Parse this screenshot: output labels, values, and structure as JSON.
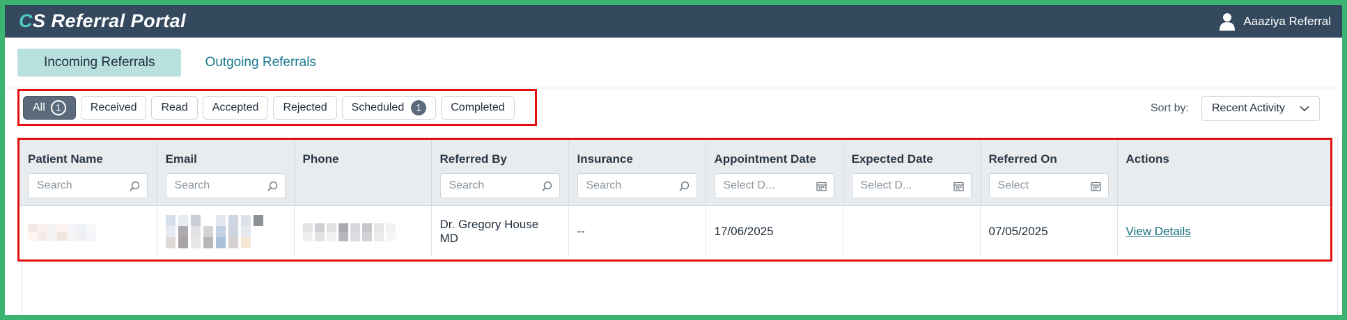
{
  "app": {
    "brand_first_letter": "C",
    "brand_rest": "S Referral Portal",
    "user_name": "Aaaziya Referral"
  },
  "tabs": [
    {
      "label": "Incoming Referrals",
      "active": true
    },
    {
      "label": "Outgoing Referrals",
      "active": false
    }
  ],
  "filters": [
    {
      "label": "All",
      "count": "1",
      "active": true
    },
    {
      "label": "Received"
    },
    {
      "label": "Read"
    },
    {
      "label": "Accepted"
    },
    {
      "label": "Rejected"
    },
    {
      "label": "Scheduled",
      "count": "1"
    },
    {
      "label": "Completed"
    }
  ],
  "sort": {
    "label": "Sort by:",
    "value": "Recent Activity"
  },
  "table": {
    "columns": [
      {
        "label": "Patient Name",
        "filter": "Search",
        "filter_icon": "search-icon"
      },
      {
        "label": "Email",
        "filter": "Search",
        "filter_icon": "search-icon"
      },
      {
        "label": "Phone",
        "filter": null
      },
      {
        "label": "Referred By",
        "filter": "Search",
        "filter_icon": "search-icon"
      },
      {
        "label": "Insurance",
        "filter": "Search",
        "filter_icon": "search-icon"
      },
      {
        "label": "Appointment Date",
        "filter": "Select D...",
        "filter_icon": "calendar-icon"
      },
      {
        "label": "Expected Date",
        "filter": "Select D...",
        "filter_icon": "calendar-icon"
      },
      {
        "label": "Referred On",
        "filter": "Select",
        "filter_icon": "calendar-icon"
      },
      {
        "label": "Actions",
        "filter": null
      }
    ],
    "rows": [
      {
        "patient_name": "",
        "email": "",
        "phone": "",
        "referred_by": "Dr. Gregory House MD",
        "insurance": "--",
        "appointment_date": "17/06/2025",
        "expected_date": "",
        "referred_on": "07/05/2025",
        "action": "View Details"
      }
    ]
  },
  "colors": {
    "topbar": "#34495e",
    "accent": "#4ecdc4",
    "highlight_border": "#e01010",
    "frame_border": "#3cb371",
    "link": "#136c7c"
  }
}
